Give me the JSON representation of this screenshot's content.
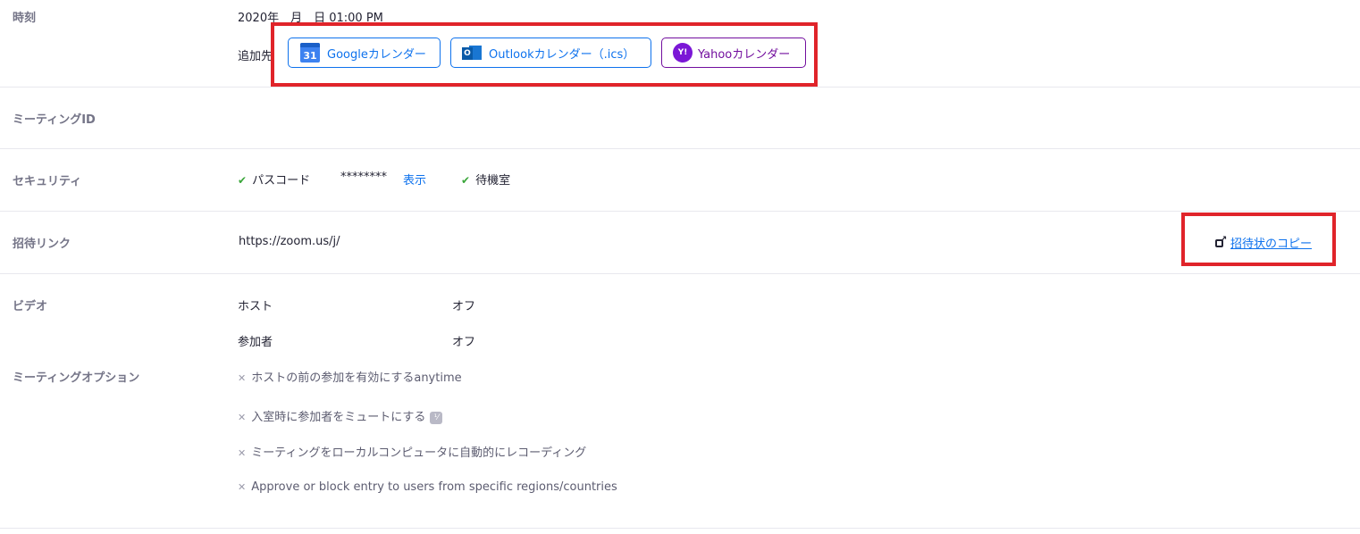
{
  "time": {
    "label": "時刻",
    "value": "2020年　月　日 01:00 PM",
    "add_to": "追加先",
    "calendars": {
      "google": {
        "icon_text": "31",
        "label": "Googleカレンダー"
      },
      "outlook": {
        "icon_text": "O",
        "label": "Outlookカレンダー（.ics）"
      },
      "yahoo": {
        "icon_text": "Y!",
        "label": "Yahooカレンダー"
      }
    }
  },
  "meeting_id": {
    "label": "ミーティングID"
  },
  "security": {
    "label": "セキュリティ",
    "passcode_label": "パスコード",
    "passcode_value": "********",
    "show_link": "表示",
    "waiting_room": "待機室",
    "check_glyph": "✔"
  },
  "invite_link": {
    "label": "招待リンク",
    "url": "https://zoom.us/j/",
    "copy_label": "招待状のコピー"
  },
  "video": {
    "label": "ビデオ",
    "host_label": "ホスト",
    "host_value": "オフ",
    "participant_label": "参加者",
    "participant_value": "オフ"
  },
  "meeting_options": {
    "label": "ミーティングオプション",
    "x_glyph": "✕",
    "badge_icon": "info-badge-icon",
    "items": [
      "ホストの前の参加を有効にするanytime",
      "入室時に参加者をミュートにする",
      "ミーティングをローカルコンピュータに自動的にレコーディング",
      "Approve or block entry to users from specific regions/countries"
    ]
  },
  "colors": {
    "accent": "#0e72ed",
    "highlight_box": "#e0242a",
    "yahoo": "#720e9e"
  }
}
